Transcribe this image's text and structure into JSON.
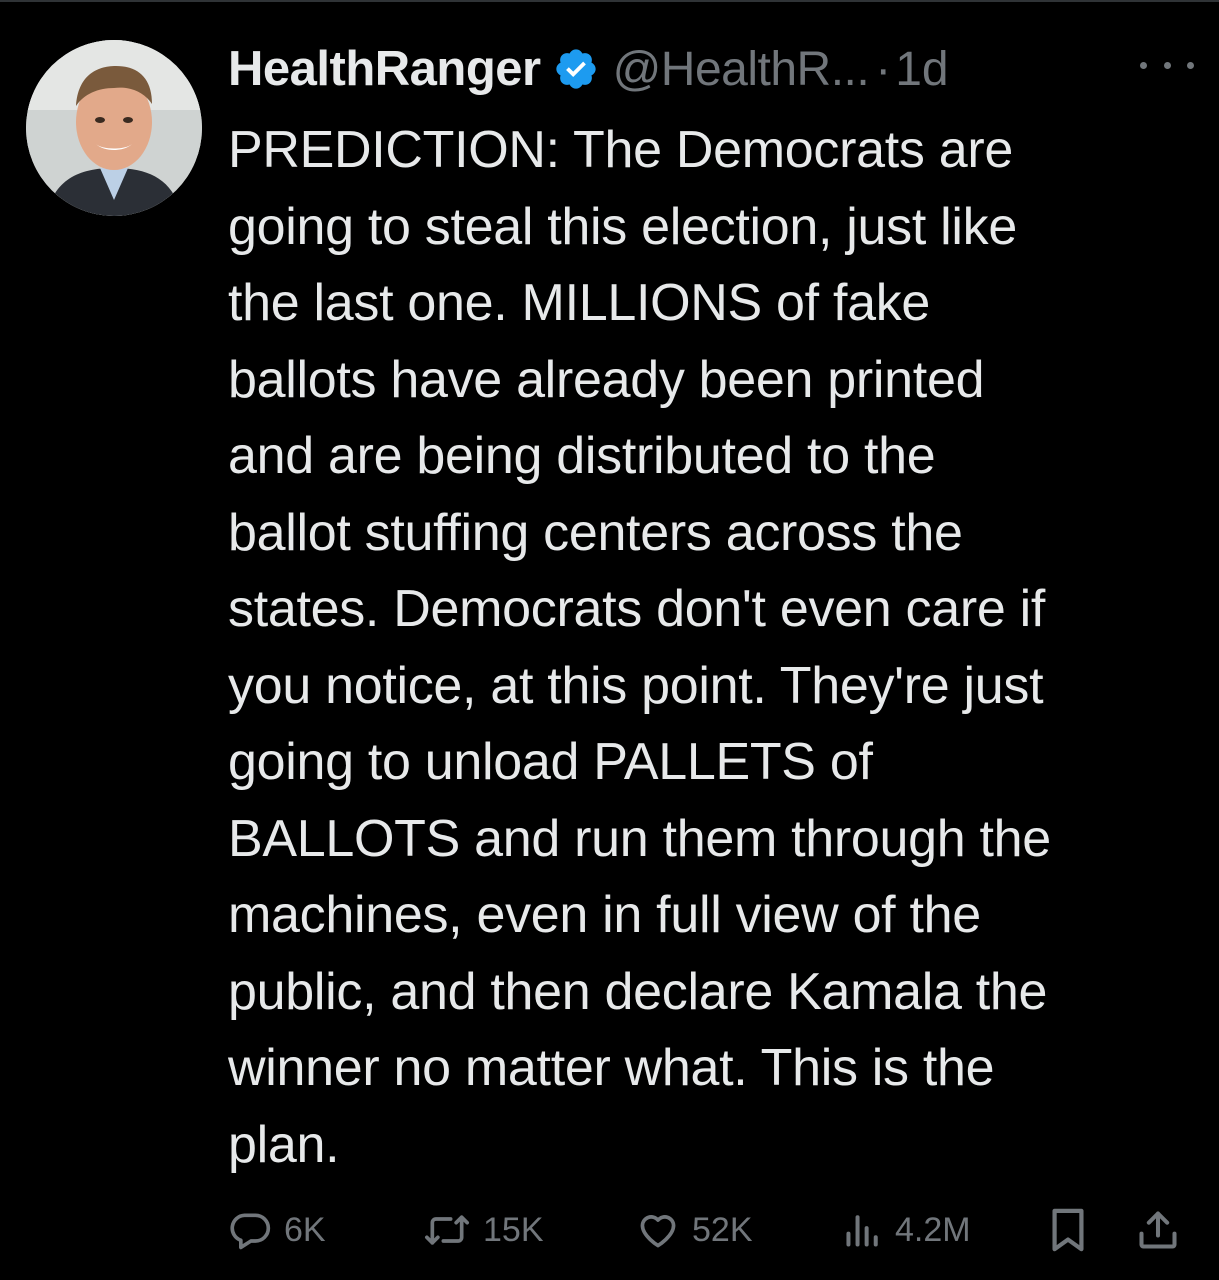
{
  "author": {
    "display_name": "HealthRanger",
    "handle": "@HealthR...",
    "separator": "·",
    "timestamp": "1d",
    "verified": true,
    "avatar_icon": "profile-photo"
  },
  "tweet": {
    "lines": [
      "PREDICTION: The Democrats are",
      "going to steal this election, just like",
      "the last one. MILLIONS of fake",
      "ballots have already been printed",
      "and are being distributed to the",
      "ballot stuffing centers across the",
      "states. Democrats don't even care if",
      "you notice, at this point. They're just",
      "going to unload PALLETS of",
      "BALLOTS and run them through the",
      "machines, even in full view of the",
      "public, and then declare Kamala the",
      "winner no matter what. This is the",
      "plan."
    ]
  },
  "actions": {
    "reply": {
      "icon": "reply-icon",
      "count": "6K"
    },
    "repost": {
      "icon": "repost-icon",
      "count": "15K"
    },
    "like": {
      "icon": "heart-icon",
      "count": "52K"
    },
    "views": {
      "icon": "views-icon",
      "count": "4.2M"
    },
    "bookmark": {
      "icon": "bookmark-icon"
    },
    "share": {
      "icon": "share-icon"
    }
  },
  "colors": {
    "background": "#000000",
    "text": "#e7e9ea",
    "secondary": "#71767b",
    "verified_badge": "#1d9bf0"
  }
}
